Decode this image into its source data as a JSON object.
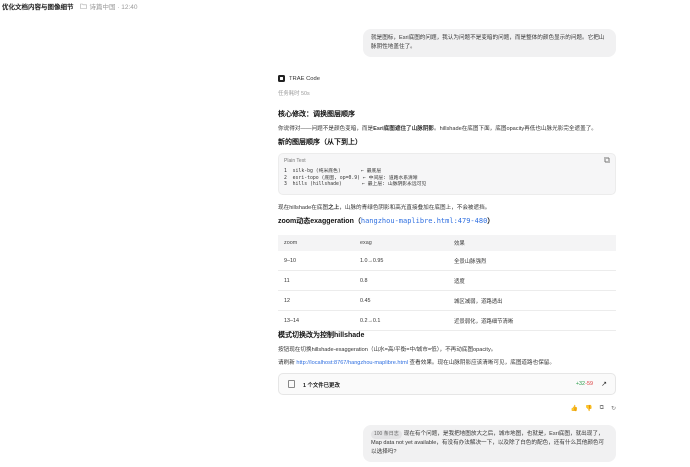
{
  "topbar": {
    "title": "优化文档内容与图像细节",
    "meta": "诗篇中国 · 12:40"
  },
  "user_message_1": {
    "text": "就是图标，Esri底图的问题，我认为问题不是变暗的问题，而是整体的颜色显示的问题。它把山脉阴性地盖住了。"
  },
  "agent": {
    "name": "TRAE Code",
    "elapsed": "任务耗时 50s",
    "h1": "核心修改：调换图层顺序",
    "p1_a": "你说得对——问题不是颜色变暗，而是",
    "p1_b": "Esri底图遮住了山脉阴影",
    "p1_c": "。hillshade在底图下面，底图opacity再低也山脉光影完全遮盖了。",
    "h2": "新的图层顺序（从下到上）",
    "code": {
      "lang": "Plain Text",
      "lines": [
        "1  silk-bg (纯米底色)       ← 最底层",
        "2  esri-topo (底图, op=0.9) ← 中间层: 道路水系清晰",
        "3  hills (hillshade)       ← 最上层: 山脉阴影永远可见"
      ]
    },
    "p2_a": "现在hillshade在底图",
    "p2_b": "之上",
    "p2_c": "，山脉的青绿色阴影和高光直接叠加在底图上，不会被遮挡。",
    "h3": "zoom动态exaggeration（",
    "h3_link": "hangzhou-maplibre.html:479-480",
    "h3_end": "）",
    "table": {
      "headers": [
        "zoom",
        "exag",
        "效果"
      ],
      "rows": [
        [
          "9–10",
          "1.0→0.95",
          "全景山脉强烈"
        ],
        [
          "11",
          "0.8",
          "适度"
        ],
        [
          "12",
          "0.45",
          "城区减弱，道路透出"
        ],
        [
          "13–14",
          "0.2→0.1",
          "近景弱化，道路细节清晰"
        ]
      ]
    },
    "h4": "模式切换改为控制hillshade",
    "p3": "按钮现在切换hillshade-exaggeration（山水=高/平衡=中/城市=低），不再动底图opacity。",
    "p4_a": "请刷新 ",
    "p4_link": "http://localhost:8767/hangzhou-maplibre.html",
    "p4_b": " 查看效果。现在山脉阴影应该清晰可见，底图道路也保留。",
    "files": {
      "label": "1 个文件已更改",
      "added": "+32",
      "removed": "-59"
    }
  },
  "user_message_2": {
    "chip": "100 条日志",
    "text": "现在有个问题，是我把地图放大之后，城市地图，也就是，Esri底图，就出现了，Map data not yet available，有没有办法解决一下，以及除了白色的配色，还有什么其他颜色可以选择吗?"
  },
  "colors": {
    "accent": "#2f6fe0",
    "added": "#2a9d4a",
    "removed": "#d93a3a",
    "bubble": "#f1f1f2"
  }
}
